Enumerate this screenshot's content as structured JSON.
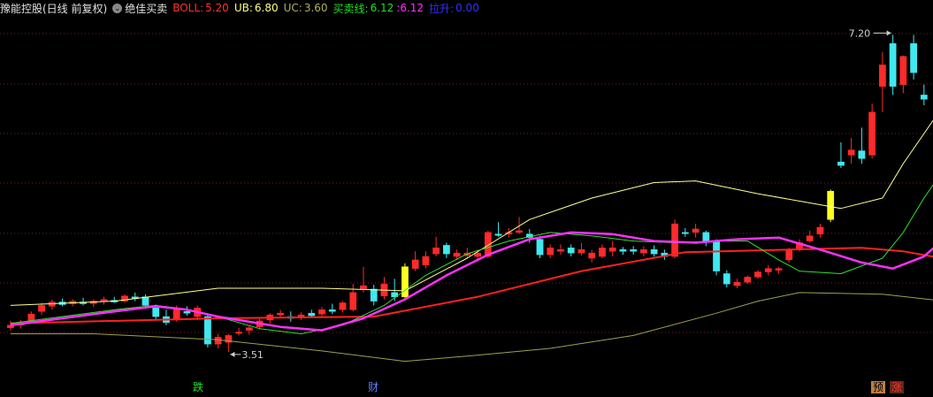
{
  "header": {
    "title": "豫能控股(日线 前复权)",
    "indicator_name": "绝佳买卖",
    "boll_label": "BOLL:",
    "boll_value": "5.20",
    "ub_label": "UB:",
    "ub_value": "6.80",
    "uc_label": "UC:",
    "uc_value": "3.60",
    "buysell_label": "买卖线:",
    "buysell_value1": "6.12",
    "buysell_value2": "6.12",
    "lift_label": "拉升:",
    "lift_value": "0.00",
    "colors": {
      "title": "#e0e0e0",
      "boll": "#ff3030",
      "ub": "#ffff80",
      "uc": "#b0b060",
      "buysell": "#20e020",
      "buysell2": "#ff30ff",
      "lift": "#3030ff"
    }
  },
  "chart_data": {
    "type": "candlestick",
    "ylim": [
      3.2,
      7.4
    ],
    "grid": "dotted horizontal",
    "annotations": {
      "high_label": "7.20",
      "low_label": "3.51"
    },
    "markers": [
      "跌",
      "财",
      "预",
      "涨"
    ],
    "candles": [
      {
        "o": 3.82,
        "h": 3.87,
        "l": 3.76,
        "c": 3.79,
        "color": "red"
      },
      {
        "o": 3.82,
        "h": 3.88,
        "l": 3.78,
        "c": 3.85,
        "color": "red"
      },
      {
        "o": 3.86,
        "h": 3.98,
        "l": 3.84,
        "c": 3.95,
        "color": "red"
      },
      {
        "o": 3.98,
        "h": 4.08,
        "l": 3.94,
        "c": 4.05,
        "color": "red"
      },
      {
        "o": 4.04,
        "h": 4.12,
        "l": 4.0,
        "c": 4.09,
        "color": "red"
      },
      {
        "o": 4.09,
        "h": 4.13,
        "l": 4.04,
        "c": 4.06,
        "color": "cyan"
      },
      {
        "o": 4.07,
        "h": 4.12,
        "l": 4.04,
        "c": 4.1,
        "color": "red"
      },
      {
        "o": 4.09,
        "h": 4.14,
        "l": 4.05,
        "c": 4.07,
        "color": "cyan"
      },
      {
        "o": 4.07,
        "h": 4.12,
        "l": 4.03,
        "c": 4.1,
        "color": "red"
      },
      {
        "o": 4.1,
        "h": 4.15,
        "l": 4.06,
        "c": 4.12,
        "color": "red"
      },
      {
        "o": 4.11,
        "h": 4.15,
        "l": 4.08,
        "c": 4.09,
        "color": "cyan"
      },
      {
        "o": 4.1,
        "h": 4.18,
        "l": 4.08,
        "c": 4.16,
        "color": "red"
      },
      {
        "o": 4.15,
        "h": 4.2,
        "l": 4.1,
        "c": 4.13,
        "color": "cyan"
      },
      {
        "o": 4.15,
        "h": 4.18,
        "l": 4.02,
        "c": 4.05,
        "color": "cyan"
      },
      {
        "o": 4.02,
        "h": 4.06,
        "l": 3.88,
        "c": 3.92,
        "color": "cyan"
      },
      {
        "o": 3.92,
        "h": 4.0,
        "l": 3.82,
        "c": 3.85,
        "color": "cyan"
      },
      {
        "o": 3.88,
        "h": 4.05,
        "l": 3.86,
        "c": 4.02,
        "color": "red"
      },
      {
        "o": 3.98,
        "h": 4.04,
        "l": 3.93,
        "c": 3.96,
        "color": "cyan"
      },
      {
        "o": 3.92,
        "h": 4.05,
        "l": 3.88,
        "c": 4.02,
        "color": "red"
      },
      {
        "o": 3.92,
        "h": 3.95,
        "l": 3.56,
        "c": 3.6,
        "color": "cyan"
      },
      {
        "o": 3.6,
        "h": 3.72,
        "l": 3.55,
        "c": 3.68,
        "color": "red"
      },
      {
        "o": 3.62,
        "h": 3.72,
        "l": 3.51,
        "c": 3.7,
        "color": "red"
      },
      {
        "o": 3.74,
        "h": 3.79,
        "l": 3.7,
        "c": 3.74,
        "color": "red"
      },
      {
        "o": 3.76,
        "h": 3.82,
        "l": 3.71,
        "c": 3.79,
        "color": "red"
      },
      {
        "o": 3.8,
        "h": 3.9,
        "l": 3.77,
        "c": 3.87,
        "color": "red"
      },
      {
        "o": 3.88,
        "h": 3.96,
        "l": 3.84,
        "c": 3.94,
        "color": "red"
      },
      {
        "o": 3.94,
        "h": 4.0,
        "l": 3.9,
        "c": 3.96,
        "color": "red"
      },
      {
        "o": 3.92,
        "h": 3.98,
        "l": 3.86,
        "c": 3.9,
        "color": "cyan"
      },
      {
        "o": 3.91,
        "h": 3.97,
        "l": 3.88,
        "c": 3.94,
        "color": "red"
      },
      {
        "o": 3.96,
        "h": 4.0,
        "l": 3.91,
        "c": 3.93,
        "color": "cyan"
      },
      {
        "o": 3.95,
        "h": 4.03,
        "l": 3.92,
        "c": 4.0,
        "color": "red"
      },
      {
        "o": 4.0,
        "h": 4.07,
        "l": 3.95,
        "c": 3.98,
        "color": "cyan"
      },
      {
        "o": 4.0,
        "h": 4.1,
        "l": 3.97,
        "c": 4.08,
        "color": "red"
      },
      {
        "o": 4.0,
        "h": 4.3,
        "l": 3.98,
        "c": 4.2,
        "color": "red"
      },
      {
        "o": 4.24,
        "h": 4.5,
        "l": 4.2,
        "c": 4.28,
        "color": "red"
      },
      {
        "o": 4.24,
        "h": 4.29,
        "l": 4.05,
        "c": 4.1,
        "color": "cyan"
      },
      {
        "o": 4.16,
        "h": 4.38,
        "l": 4.12,
        "c": 4.3,
        "color": "red"
      },
      {
        "o": 4.2,
        "h": 4.36,
        "l": 4.1,
        "c": 4.15,
        "color": "cyan"
      },
      {
        "o": 4.15,
        "h": 4.54,
        "l": 4.13,
        "c": 4.5,
        "color": "yellow"
      },
      {
        "o": 4.48,
        "h": 4.68,
        "l": 4.45,
        "c": 4.58,
        "color": "red"
      },
      {
        "o": 4.52,
        "h": 4.68,
        "l": 4.48,
        "c": 4.62,
        "color": "red"
      },
      {
        "o": 4.65,
        "h": 4.85,
        "l": 4.62,
        "c": 4.72,
        "color": "red"
      },
      {
        "o": 4.75,
        "h": 4.78,
        "l": 4.6,
        "c": 4.65,
        "color": "cyan"
      },
      {
        "o": 4.62,
        "h": 4.7,
        "l": 4.58,
        "c": 4.66,
        "color": "red"
      },
      {
        "o": 4.66,
        "h": 4.72,
        "l": 4.6,
        "c": 4.63,
        "color": "red"
      },
      {
        "o": 4.62,
        "h": 4.7,
        "l": 4.56,
        "c": 4.66,
        "color": "red"
      },
      {
        "o": 4.62,
        "h": 4.92,
        "l": 4.6,
        "c": 4.9,
        "color": "red"
      },
      {
        "o": 4.88,
        "h": 5.02,
        "l": 4.85,
        "c": 4.88,
        "color": "cyan"
      },
      {
        "o": 4.88,
        "h": 4.95,
        "l": 4.84,
        "c": 4.9,
        "color": "red"
      },
      {
        "o": 4.9,
        "h": 5.08,
        "l": 4.88,
        "c": 4.92,
        "color": "red"
      },
      {
        "o": 4.88,
        "h": 4.94,
        "l": 4.78,
        "c": 4.84,
        "color": "cyan"
      },
      {
        "o": 4.82,
        "h": 4.86,
        "l": 4.6,
        "c": 4.64,
        "color": "cyan"
      },
      {
        "o": 4.64,
        "h": 4.76,
        "l": 4.6,
        "c": 4.72,
        "color": "red"
      },
      {
        "o": 4.7,
        "h": 4.76,
        "l": 4.64,
        "c": 4.68,
        "color": "red"
      },
      {
        "o": 4.72,
        "h": 4.76,
        "l": 4.62,
        "c": 4.66,
        "color": "cyan"
      },
      {
        "o": 4.66,
        "h": 4.78,
        "l": 4.63,
        "c": 4.7,
        "color": "red"
      },
      {
        "o": 4.66,
        "h": 4.7,
        "l": 4.55,
        "c": 4.6,
        "color": "red"
      },
      {
        "o": 4.62,
        "h": 4.76,
        "l": 4.6,
        "c": 4.72,
        "color": "red"
      },
      {
        "o": 4.72,
        "h": 4.8,
        "l": 4.62,
        "c": 4.68,
        "color": "red"
      },
      {
        "o": 4.68,
        "h": 4.73,
        "l": 4.64,
        "c": 4.7,
        "color": "cyan"
      },
      {
        "o": 4.7,
        "h": 4.74,
        "l": 4.64,
        "c": 4.68,
        "color": "cyan"
      },
      {
        "o": 4.66,
        "h": 4.74,
        "l": 4.62,
        "c": 4.7,
        "color": "red"
      },
      {
        "o": 4.7,
        "h": 4.75,
        "l": 4.62,
        "c": 4.65,
        "color": "cyan"
      },
      {
        "o": 4.62,
        "h": 4.7,
        "l": 4.58,
        "c": 4.66,
        "color": "cyan"
      },
      {
        "o": 4.62,
        "h": 5.05,
        "l": 4.6,
        "c": 5.0,
        "color": "red"
      },
      {
        "o": 4.9,
        "h": 4.95,
        "l": 4.85,
        "c": 4.9,
        "color": "cyan"
      },
      {
        "o": 4.9,
        "h": 5.0,
        "l": 4.84,
        "c": 4.94,
        "color": "red"
      },
      {
        "o": 4.9,
        "h": 4.92,
        "l": 4.74,
        "c": 4.8,
        "color": "cyan"
      },
      {
        "o": 4.8,
        "h": 4.82,
        "l": 4.4,
        "c": 4.45,
        "color": "cyan"
      },
      {
        "o": 4.42,
        "h": 4.46,
        "l": 4.26,
        "c": 4.3,
        "color": "cyan"
      },
      {
        "o": 4.28,
        "h": 4.36,
        "l": 4.25,
        "c": 4.32,
        "color": "red"
      },
      {
        "o": 4.32,
        "h": 4.4,
        "l": 4.3,
        "c": 4.38,
        "color": "red"
      },
      {
        "o": 4.38,
        "h": 4.46,
        "l": 4.36,
        "c": 4.44,
        "color": "red"
      },
      {
        "o": 4.44,
        "h": 4.52,
        "l": 4.4,
        "c": 4.48,
        "color": "red"
      },
      {
        "o": 4.46,
        "h": 4.5,
        "l": 4.42,
        "c": 4.48,
        "color": "red"
      },
      {
        "o": 4.58,
        "h": 4.72,
        "l": 4.55,
        "c": 4.7,
        "color": "red"
      },
      {
        "o": 4.7,
        "h": 4.82,
        "l": 4.68,
        "c": 4.78,
        "color": "red"
      },
      {
        "o": 4.8,
        "h": 4.92,
        "l": 4.78,
        "c": 4.86,
        "color": "red"
      },
      {
        "o": 4.88,
        "h": 5.0,
        "l": 4.84,
        "c": 4.96,
        "color": "red"
      },
      {
        "o": 5.05,
        "h": 5.4,
        "l": 5.02,
        "c": 5.38,
        "color": "yellow"
      },
      {
        "o": 5.68,
        "h": 5.95,
        "l": 5.65,
        "c": 5.72,
        "color": "cyan"
      },
      {
        "o": 5.8,
        "h": 6.0,
        "l": 5.7,
        "c": 5.86,
        "color": "red"
      },
      {
        "o": 5.85,
        "h": 6.12,
        "l": 5.7,
        "c": 5.76,
        "color": "cyan"
      },
      {
        "o": 5.8,
        "h": 6.4,
        "l": 5.76,
        "c": 6.3,
        "color": "red"
      },
      {
        "o": 6.6,
        "h": 7.0,
        "l": 6.3,
        "c": 6.85,
        "color": "red"
      },
      {
        "o": 6.6,
        "h": 7.2,
        "l": 6.5,
        "c": 7.1,
        "color": "cyan"
      },
      {
        "o": 6.62,
        "h": 6.96,
        "l": 6.52,
        "c": 6.95,
        "color": "red"
      },
      {
        "o": 7.1,
        "h": 7.2,
        "l": 6.68,
        "c": 6.76,
        "color": "cyan"
      },
      {
        "o": 6.45,
        "h": 6.62,
        "l": 6.38,
        "c": 6.5,
        "color": "cyan"
      }
    ],
    "series": [
      {
        "name": "BOLL",
        "color": "#ff2020",
        "width": 2,
        "points": [
          [
            0,
            3.84
          ],
          [
            20,
            3.9
          ],
          [
            35,
            3.92
          ],
          [
            45,
            4.15
          ],
          [
            55,
            4.45
          ],
          [
            65,
            4.67
          ],
          [
            75,
            4.7
          ],
          [
            82,
            4.72
          ],
          [
            86,
            4.68
          ],
          [
            92,
            4.55
          ],
          [
            95,
            4.6
          ],
          [
            100,
            4.85
          ],
          [
            105,
            5.3
          ]
        ]
      },
      {
        "name": "UB",
        "color": "#ffff90",
        "width": 1,
        "points": [
          [
            0,
            4.05
          ],
          [
            10,
            4.1
          ],
          [
            20,
            4.25
          ],
          [
            30,
            4.25
          ],
          [
            38,
            4.22
          ],
          [
            44,
            4.6
          ],
          [
            50,
            5.05
          ],
          [
            56,
            5.3
          ],
          [
            62,
            5.48
          ],
          [
            66,
            5.5
          ],
          [
            72,
            5.35
          ],
          [
            80,
            5.18
          ],
          [
            84,
            5.3
          ],
          [
            86,
            5.7
          ],
          [
            90,
            6.4
          ],
          [
            94,
            6.72
          ],
          [
            100,
            6.72
          ],
          [
            105,
            6.7
          ]
        ]
      },
      {
        "name": "UC",
        "color": "#a0a050",
        "width": 1,
        "points": [
          [
            0,
            3.72
          ],
          [
            8,
            3.72
          ],
          [
            20,
            3.65
          ],
          [
            30,
            3.52
          ],
          [
            38,
            3.4
          ],
          [
            44,
            3.46
          ],
          [
            52,
            3.55
          ],
          [
            60,
            3.7
          ],
          [
            68,
            3.96
          ],
          [
            72,
            4.1
          ],
          [
            76,
            4.2
          ],
          [
            84,
            4.18
          ],
          [
            90,
            4.1
          ],
          [
            94,
            3.8
          ],
          [
            96,
            3.56
          ],
          [
            98,
            3.4
          ]
        ]
      },
      {
        "name": "买卖线",
        "color": "#30e030",
        "width": 1,
        "points": [
          [
            0,
            3.84
          ],
          [
            10,
            4.0
          ],
          [
            14,
            4.05
          ],
          [
            16,
            4.02
          ],
          [
            20,
            3.92
          ],
          [
            24,
            3.78
          ],
          [
            28,
            3.72
          ],
          [
            32,
            3.82
          ],
          [
            36,
            4.05
          ],
          [
            40,
            4.4
          ],
          [
            44,
            4.65
          ],
          [
            48,
            4.8
          ],
          [
            52,
            4.9
          ],
          [
            56,
            4.86
          ],
          [
            60,
            4.8
          ],
          [
            64,
            4.78
          ],
          [
            68,
            4.8
          ],
          [
            71,
            4.8
          ],
          [
            74,
            4.58
          ],
          [
            76,
            4.45
          ],
          [
            80,
            4.42
          ],
          [
            84,
            4.6
          ],
          [
            86,
            4.9
          ],
          [
            88,
            5.3
          ],
          [
            92,
            6.0
          ],
          [
            96,
            6.6
          ],
          [
            100,
            6.85
          ],
          [
            105,
            6.85
          ]
        ]
      },
      {
        "name": "买卖线2",
        "color": "#ff30ff",
        "width": 2.5,
        "points": [
          [
            0,
            3.82
          ],
          [
            10,
            3.98
          ],
          [
            14,
            4.04
          ],
          [
            17,
            4.0
          ],
          [
            20,
            3.92
          ],
          [
            26,
            3.8
          ],
          [
            30,
            3.76
          ],
          [
            34,
            3.9
          ],
          [
            38,
            4.12
          ],
          [
            42,
            4.4
          ],
          [
            46,
            4.64
          ],
          [
            50,
            4.82
          ],
          [
            54,
            4.9
          ],
          [
            58,
            4.88
          ],
          [
            62,
            4.8
          ],
          [
            66,
            4.78
          ],
          [
            70,
            4.82
          ],
          [
            74,
            4.84
          ],
          [
            78,
            4.7
          ],
          [
            82,
            4.55
          ],
          [
            85,
            4.48
          ],
          [
            88,
            4.62
          ],
          [
            92,
            5.05
          ],
          [
            96,
            5.62
          ],
          [
            100,
            6.05
          ],
          [
            105,
            6.12
          ]
        ]
      }
    ]
  }
}
